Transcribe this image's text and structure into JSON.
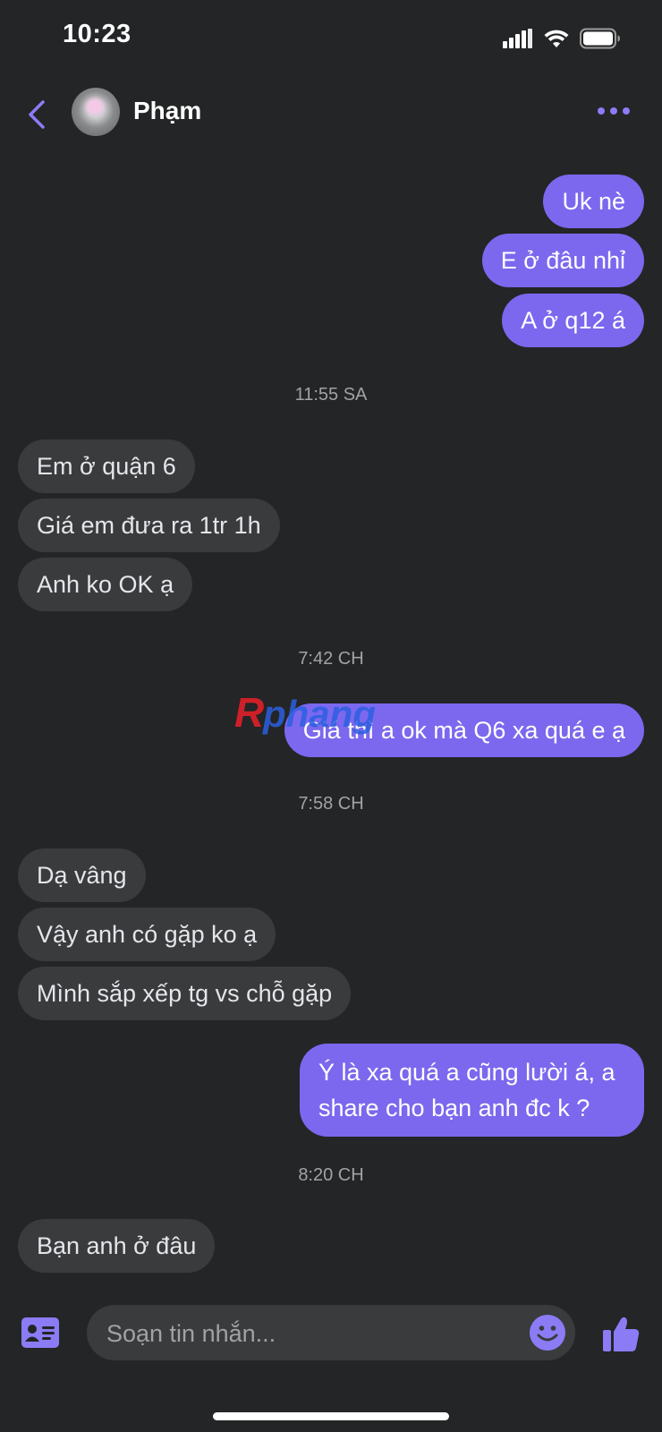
{
  "status_bar": {
    "time": "10:23"
  },
  "header": {
    "contact_name": "Phạm"
  },
  "messages": [
    {
      "type": "out",
      "text": "Uk nè"
    },
    {
      "type": "out",
      "text": "E ở đâu nhỉ"
    },
    {
      "type": "out",
      "text": "A ở q12 á"
    },
    {
      "type": "timestamp",
      "text": "11:55 SA"
    },
    {
      "type": "in",
      "text": "Em ở quận 6"
    },
    {
      "type": "in",
      "text": "Giá em đưa ra 1tr 1h"
    },
    {
      "type": "in",
      "text": "Anh ko OK ạ"
    },
    {
      "type": "timestamp",
      "text": "7:42 CH"
    },
    {
      "type": "out",
      "text": "Giá thì a ok mà Q6 xa quá e ạ"
    },
    {
      "type": "timestamp",
      "text": "7:58 CH"
    },
    {
      "type": "in",
      "text": "Dạ vâng"
    },
    {
      "type": "in",
      "text": "Vậy anh có gặp ko ạ"
    },
    {
      "type": "in",
      "text": "Mình sắp xếp tg vs chỗ gặp"
    },
    {
      "type": "out",
      "text": "Ý là xa quá a cũng lười á, a share cho bạn anh đc k ?"
    },
    {
      "type": "timestamp",
      "text": "8:20 CH"
    },
    {
      "type": "in",
      "text": "Bạn anh ở đâu"
    }
  ],
  "watermark": {
    "text": "Rphang"
  },
  "composer": {
    "placeholder": "Soạn tin nhắn..."
  },
  "colors": {
    "background": "#242526",
    "outgoing_bubble": "#7b68ee",
    "incoming_bubble": "#3a3b3c",
    "accent": "#8b7cf6"
  },
  "icons": {
    "back": "chevron-left-icon",
    "more": "more-horizontal-icon",
    "contact_card": "contact-card-icon",
    "emoji": "emoji-icon",
    "like": "thumbs-up-icon"
  }
}
